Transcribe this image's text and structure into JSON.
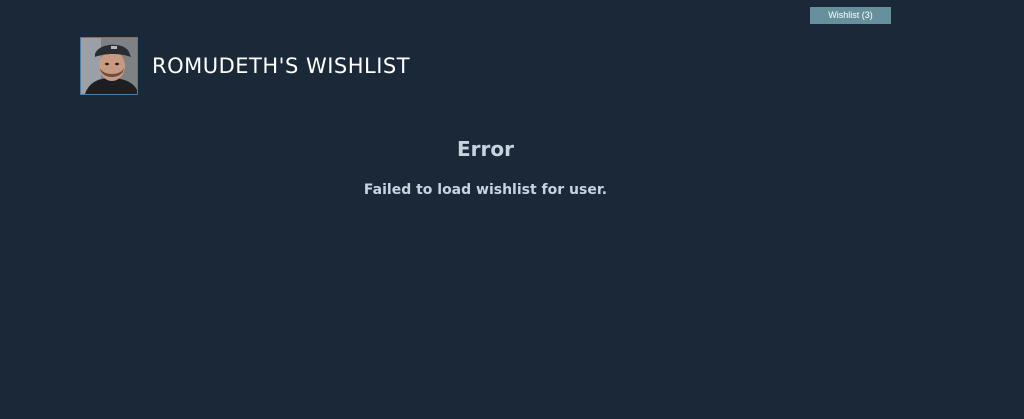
{
  "nav": {
    "wishlist_button_label": "Wishlist (3)"
  },
  "profile": {
    "title": "ROMUDETH'S WISHLIST",
    "avatar_icon": "user-avatar"
  },
  "error": {
    "title": "Error",
    "message": "Failed to load wishlist for user."
  },
  "colors": {
    "background": "#1b2838",
    "button_bg": "#67909d",
    "text_primary": "#ffffff",
    "text_secondary": "#c6d4df",
    "avatar_border": "#4a7ea6"
  }
}
